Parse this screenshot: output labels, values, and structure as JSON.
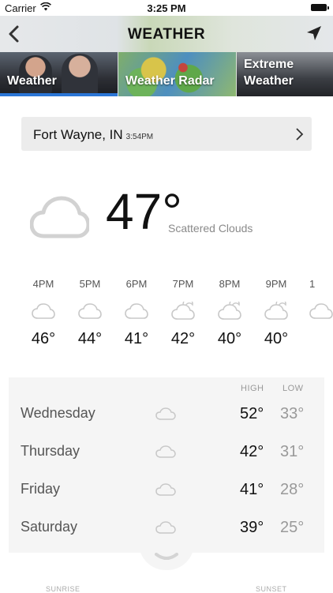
{
  "status_bar": {
    "carrier": "Carrier",
    "time": "3:25 PM"
  },
  "header": {
    "title": "WEATHER"
  },
  "tabs": [
    {
      "label": "Weather",
      "selected": true
    },
    {
      "label": "Weather Radar",
      "selected": false
    },
    {
      "label": "Extreme\nWeather",
      "selected": false
    }
  ],
  "location": {
    "city": "Fort Wayne, IN",
    "updated": "3:54PM"
  },
  "current": {
    "temp": "47°",
    "condition": "Scattered Clouds",
    "icon": "cloud-icon"
  },
  "hourly": [
    {
      "time": "4PM",
      "temp": "46°",
      "icon": "cloud-icon"
    },
    {
      "time": "5PM",
      "temp": "44°",
      "icon": "cloud-icon"
    },
    {
      "time": "6PM",
      "temp": "41°",
      "icon": "cloud-icon"
    },
    {
      "time": "7PM",
      "temp": "42°",
      "icon": "cloud-moon-icon"
    },
    {
      "time": "8PM",
      "temp": "40°",
      "icon": "cloud-moon-icon"
    },
    {
      "time": "9PM",
      "temp": "40°",
      "icon": "cloud-moon-icon"
    },
    {
      "time": "1",
      "temp": "",
      "icon": "cloud-icon"
    }
  ],
  "daily": {
    "high_label": "HIGH",
    "low_label": "LOW",
    "days": [
      {
        "day": "Wednesday",
        "high": "52°",
        "low": "33°",
        "icon": "cloud-icon"
      },
      {
        "day": "Thursday",
        "high": "42°",
        "low": "31°",
        "icon": "cloud-icon"
      },
      {
        "day": "Friday",
        "high": "41°",
        "low": "28°",
        "icon": "cloud-icon"
      },
      {
        "day": "Saturday",
        "high": "39°",
        "low": "25°",
        "icon": "cloud-icon"
      }
    ]
  },
  "footer": {
    "sunrise_label": "SUNRISE",
    "sunset_label": "SUNSET"
  },
  "colors": {
    "accent": "#2b76d6",
    "panel": "#f5f5f5",
    "muted": "#999999"
  }
}
